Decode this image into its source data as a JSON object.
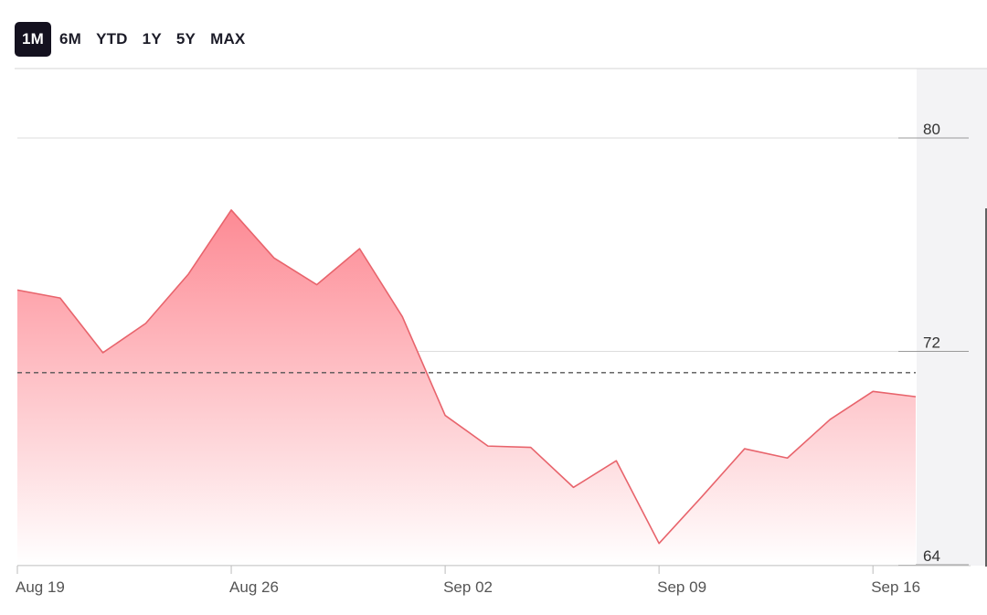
{
  "range_tabs": {
    "items": [
      "1M",
      "6M",
      "YTD",
      "1Y",
      "5Y",
      "MAX"
    ],
    "active": "1M"
  },
  "colors": {
    "line": "#e8646c",
    "fill_top": "#fd8a94",
    "fill_bottom": "#ffffff",
    "reference_line": "#555555",
    "grid": "#dddddd",
    "tab_active_bg": "#14111f"
  },
  "chart_data": {
    "type": "area",
    "x": [
      "Aug 19",
      "Aug 20",
      "Aug 21",
      "Aug 22",
      "Aug 23",
      "Aug 26",
      "Aug 27",
      "Aug 28",
      "Aug 29",
      "Aug 30",
      "Sep 02",
      "Sep 03",
      "Sep 04",
      "Sep 05",
      "Sep 06",
      "Sep 09",
      "Sep 10",
      "Sep 11",
      "Sep 12",
      "Sep 13",
      "Sep 16",
      "Sep 17"
    ],
    "values": [
      74.3,
      74.0,
      71.95,
      73.05,
      74.9,
      77.3,
      75.5,
      74.5,
      75.85,
      73.3,
      69.6,
      68.45,
      68.4,
      66.9,
      67.9,
      64.8,
      66.55,
      68.35,
      68.0,
      69.45,
      70.5,
      70.3
    ],
    "reference_line": 71.2,
    "x_ticks": [
      "Aug 19",
      "Aug 26",
      "Sep 02",
      "Sep 09",
      "Sep 16"
    ],
    "y_ticks": [
      64,
      72,
      80
    ],
    "ylim": [
      64,
      80
    ],
    "grid": true,
    "legend": "none",
    "title": "",
    "xlabel": "",
    "ylabel": ""
  }
}
